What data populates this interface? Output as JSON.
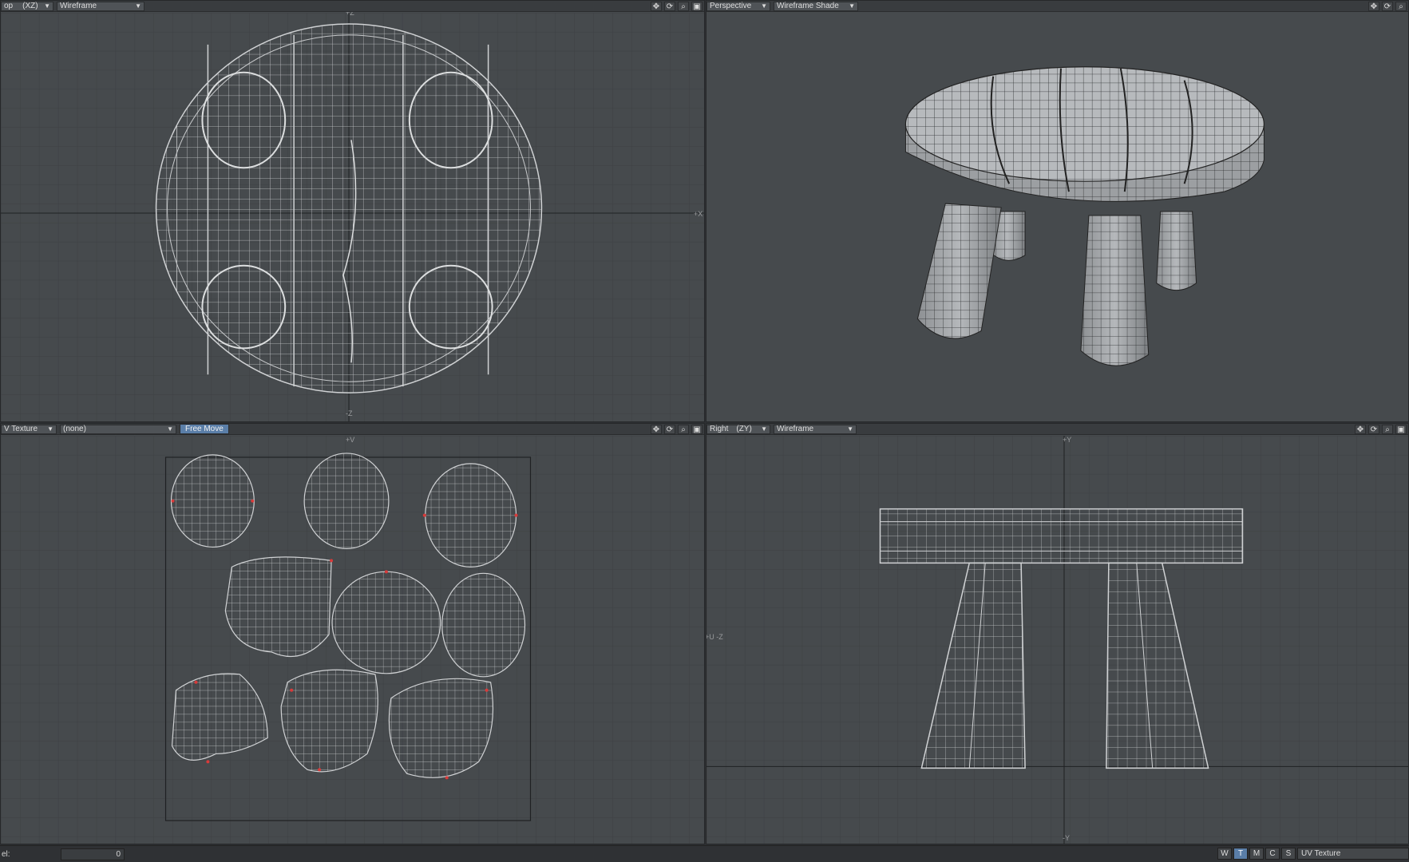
{
  "viewports": {
    "top_left": {
      "view_name": "op",
      "axis": "(XZ)",
      "render_mode": "Wireframe",
      "axis_labels": {
        "top": "+Z",
        "right": "+X",
        "bottom": "-Z"
      }
    },
    "top_right": {
      "view_name": "Perspective",
      "render_mode": "Wireframe Shade"
    },
    "bottom_left": {
      "view_name": "V Texture",
      "map_select": "(none)",
      "tool_mode": "Free Move",
      "axis_labels": {
        "top": "+V"
      }
    },
    "bottom_right": {
      "view_name": "Right",
      "axis": "(ZY)",
      "render_mode": "Wireframe",
      "axis_labels": {
        "top": "+Y",
        "left": "+U -Z",
        "bottom": "-Y"
      }
    }
  },
  "viewport_tools": [
    "move-view",
    "rotate-view",
    "zoom-view",
    "maximize-view"
  ],
  "statusbar": {
    "label": "el:",
    "value": "0",
    "modes": [
      "W",
      "T",
      "M",
      "C",
      "S"
    ],
    "active_mode": "T",
    "map_type": "UV Texture"
  },
  "colors": {
    "viewport_bg": "#464a4d",
    "grid": "#3d4043",
    "wire": "#c8cacc",
    "seam": "#d83a3a",
    "active_button": "#5a7ea8"
  }
}
